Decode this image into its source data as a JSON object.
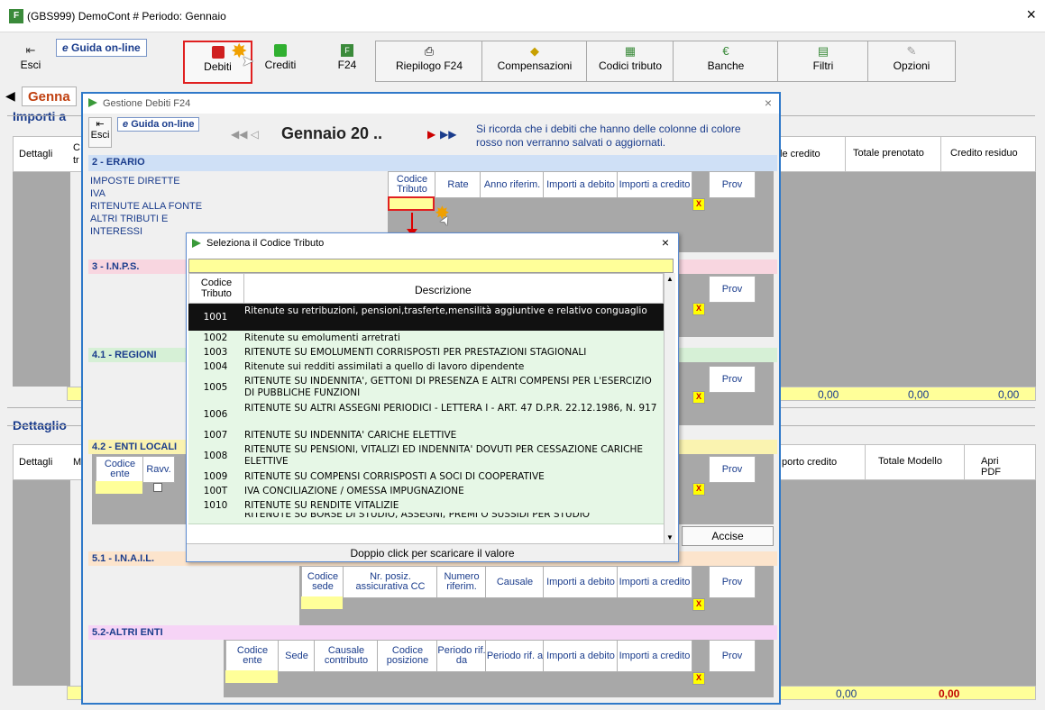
{
  "window": {
    "title": "(GBS999) DemoCont # Periodo: Gennaio",
    "close": "×"
  },
  "toolbar": {
    "esci": "Esci",
    "guida": "Guida on-line",
    "debiti": "Debiti",
    "crediti": "Crediti",
    "f24": "F24",
    "riepilogo": "Riepilogo F24",
    "compensazioni": "Compensazioni",
    "codici": "Codici tributo",
    "banche": "Banche",
    "filtri": "Filtri",
    "opzioni": "Opzioni"
  },
  "main": {
    "month_tab": "Genna",
    "importi_title": "Importi a",
    "dettaglio_title": "Dettaglio",
    "col_dettagli": "Dettagli",
    "col_c": "C",
    "col_tr": "tr",
    "col_m": "M",
    "col_totale_credito": "le credito",
    "col_totale_prenotato": "Totale prenotato",
    "col_credito_residuo": "Credito residuo",
    "col_importo_credito": "porto credito",
    "col_totale_modello": "Totale Modello",
    "col_apri_pdf": "Apri PDF",
    "val1": "0,00",
    "val2": "0,00",
    "val3": "0,00",
    "val4": "0,00",
    "val5": "0,00"
  },
  "dlg1": {
    "title": "Gestione Debiti F24",
    "close": "×",
    "esci": "Esci",
    "guida": "Guida on-line",
    "period": "Gennaio 20 ..",
    "note": "Si ricorda che i debiti che hanno delle colonne di colore rosso non verranno salvati o aggiornati.",
    "erario": {
      "title": "2 - ERARIO",
      "items": [
        "IMPOSTE DIRETTE",
        "IVA",
        "RITENUTE ALLA FONTE",
        "ALTRI TRIBUTI E INTERESSI"
      ],
      "cols": [
        "Codice Tributo",
        "Rate",
        "Anno riferim.",
        "Importi a debito",
        "Importi a credito",
        "Prov"
      ]
    },
    "inps": {
      "title": "3 - I.N.P.S.",
      "prov": "Prov"
    },
    "regioni": {
      "title": "4.1 - REGIONI",
      "prov": "Prov"
    },
    "enti": {
      "title": "4.2 - ENTI LOCALI",
      "cols": [
        "Codice ente",
        "Ravv."
      ],
      "prov": "Prov",
      "accise": "Accise"
    },
    "inail": {
      "title": "5.1 - I.N.A.I.L.",
      "cols": [
        "Codice sede",
        "Nr. posiz. assicurativa CC",
        "Numero riferim.",
        "Causale",
        "Importi a debito",
        "Importi a credito",
        "Prov"
      ]
    },
    "altri": {
      "title": "5.2-ALTRI ENTI",
      "cols": [
        "Codice ente",
        "Sede",
        "Causale contributo",
        "Codice posizione",
        "Periodo rif. da",
        "Periodo rif. a",
        "Importi a debito",
        "Importi a credito",
        "Prov"
      ]
    },
    "x": "X"
  },
  "dlg2": {
    "title": "Seleziona il Codice Tributo",
    "close": "×",
    "col_code": "Codice Tributo",
    "col_desc": "Descrizione",
    "footer": "Doppio click per scaricare il valore",
    "rows": [
      {
        "code": "1001",
        "desc": "Ritenute su retribuzioni, pensioni,trasferte,mensilità aggiuntive e relativo conguaglio"
      },
      {
        "code": "1002",
        "desc": "Ritenute su emolumenti arretrati"
      },
      {
        "code": "1003",
        "desc": "RITENUTE SU EMOLUMENTI CORRISPOSTI PER PRESTAZIONI STAGIONALI"
      },
      {
        "code": "1004",
        "desc": "Ritenute sui redditi assimilati a quello di lavoro dipendente"
      },
      {
        "code": "1005",
        "desc": "RITENUTE SU INDENNITA', GETTONI DI PRESENZA E ALTRI COMPENSI PER L'ESERCIZIO DI PUBBLICHE FUNZIONI"
      },
      {
        "code": "1006",
        "desc": "RITENUTE SU ALTRI ASSEGNI PERIODICI - LETTERA I - ART. 47 D.P.R. 22.12.1986, N. 917"
      },
      {
        "code": "1007",
        "desc": "RITENUTE SU INDENNITA' CARICHE ELETTIVE"
      },
      {
        "code": "1008",
        "desc": "RITENUTE SU PENSIONI, VITALIZI ED INDENNITA' DOVUTI PER CESSAZIONE CARICHE ELETTIVE"
      },
      {
        "code": "1009",
        "desc": "RITENUTE SU COMPENSI CORRISPOSTI A SOCI DI COOPERATIVE"
      },
      {
        "code": "100T",
        "desc": "IVA CONCILIAZIONE /  OMESSA IMPUGNAZIONE"
      },
      {
        "code": "1010",
        "desc": "RITENUTE SU RENDITE VITALIZIE"
      },
      {
        "code": "",
        "desc": "RITENUTE SU BORSE DI STUDIO, ASSEGNI, PREMI O SUSSIDI PER STUDIO"
      }
    ]
  }
}
